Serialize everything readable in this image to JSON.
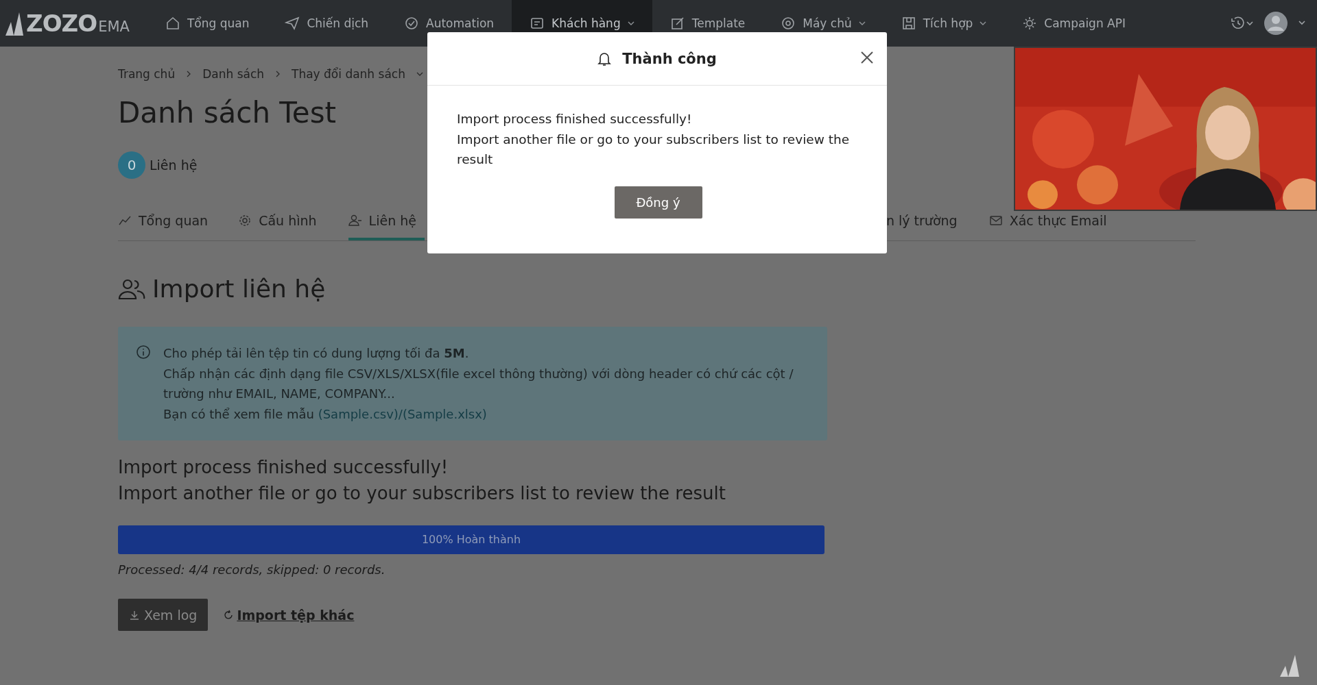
{
  "nav": {
    "logo": "ZOZO",
    "logo_suffix": "EMA",
    "items": [
      {
        "label": "Tổng quan",
        "selected": false,
        "has_menu": false
      },
      {
        "label": "Chiến dịch",
        "selected": false,
        "has_menu": false
      },
      {
        "label": "Automation",
        "selected": false,
        "has_menu": false
      },
      {
        "label": "Khách hàng",
        "selected": true,
        "has_menu": true
      },
      {
        "label": "Template",
        "selected": false,
        "has_menu": false
      },
      {
        "label": "Máy chủ",
        "selected": false,
        "has_menu": true
      },
      {
        "label": "Tích hợp",
        "selected": false,
        "has_menu": true
      },
      {
        "label": "Campaign API",
        "selected": false,
        "has_menu": false
      }
    ]
  },
  "breadcrumb": [
    "Trang chủ",
    "Danh sách",
    "Thay đổi danh sách"
  ],
  "title": "Danh sách Test",
  "contacts": {
    "count": "0",
    "label": "Liên hệ"
  },
  "tabs": [
    {
      "label": "Tổng quan",
      "selected": false
    },
    {
      "label": "Cấu hình",
      "selected": false
    },
    {
      "label": "Liên hệ",
      "selected": true
    },
    {
      "label": "n lý trường",
      "selected": false
    },
    {
      "label": "Xác thực Email",
      "selected": false
    }
  ],
  "section_title": "Import liên hệ",
  "info": [
    "Cho phép tải lên tệp tin có dung lượng tối đa **5M**.",
    "Chấp nhận các định dạng file CSV/XLS/XLSX(file excel thông thường) với dòng header có chứ các cột / trường như EMAIL, NAME, COMPANY...",
    {
      "text": "Bạn có thể xem file mẫu",
      "links": [
        "(Sample.csv)",
        "/(Sample.xlsx)"
      ]
    }
  ],
  "result": [
    "Import process finished successfully!",
    "Import another file or go to your subscribers list to review the result"
  ],
  "progress": {
    "level": 1,
    "label": "100% Hoàn thành"
  },
  "processed": "Processed: 4/4 records, skipped: 0 records.",
  "buttons": {
    "log": "Xem log",
    "again": "Import tệp khác"
  },
  "modal": {
    "title": "Thành công",
    "lines": [
      "Import process finished successfully!",
      "Import another file or go to your subscribers list to review the result"
    ],
    "ok": "Đồng ý"
  },
  "video": {
    "kind": "picture"
  }
}
